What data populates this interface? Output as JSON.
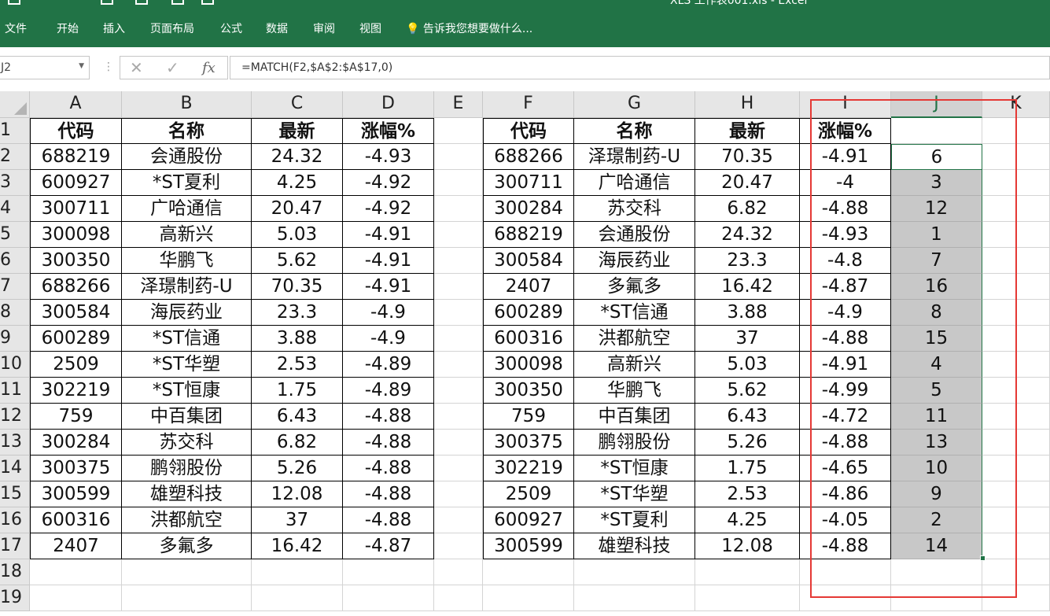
{
  "window": {
    "title": "XLS 工作表001.xls - Excel"
  },
  "ribbon": {
    "tabs": [
      "文件",
      "开始",
      "插入",
      "页面布局",
      "公式",
      "数据",
      "审阅",
      "视图"
    ],
    "tell_me": "告诉我您想要做什么..."
  },
  "formula_bar": {
    "name_box": "J2",
    "cancel_icon": "✕",
    "enter_icon": "✓",
    "fx_label": "fx",
    "formula": "=MATCH(F2,$A$2:$A$17,0)"
  },
  "sheet": {
    "columns": [
      "A",
      "B",
      "C",
      "D",
      "E",
      "F",
      "G",
      "H",
      "I",
      "J",
      "K"
    ],
    "rows": [
      "1",
      "2",
      "3",
      "4",
      "5",
      "6",
      "7",
      "8",
      "9",
      "10",
      "11",
      "12",
      "13",
      "14",
      "15",
      "16",
      "17",
      "18",
      "19"
    ],
    "selected_column": "J",
    "active_cell": "J2",
    "left_table": {
      "headers": [
        "代码",
        "名称",
        "最新",
        "涨幅%"
      ],
      "rows": [
        [
          "688219",
          "会通股份",
          "24.32",
          "-4.93"
        ],
        [
          "600927",
          "*ST夏利",
          "4.25",
          "-4.92"
        ],
        [
          "300711",
          "广哈通信",
          "20.47",
          "-4.92"
        ],
        [
          "300098",
          "高新兴",
          "5.03",
          "-4.91"
        ],
        [
          "300350",
          "华鹏飞",
          "5.62",
          "-4.91"
        ],
        [
          "688266",
          "泽璟制药-U",
          "70.35",
          "-4.91"
        ],
        [
          "300584",
          "海辰药业",
          "23.3",
          "-4.9"
        ],
        [
          "600289",
          "*ST信通",
          "3.88",
          "-4.9"
        ],
        [
          "2509",
          "*ST华塑",
          "2.53",
          "-4.89"
        ],
        [
          "302219",
          "*ST恒康",
          "1.75",
          "-4.89"
        ],
        [
          "759",
          "中百集团",
          "6.43",
          "-4.88"
        ],
        [
          "300284",
          "苏交科",
          "6.82",
          "-4.88"
        ],
        [
          "300375",
          "鹏翎股份",
          "5.26",
          "-4.88"
        ],
        [
          "300599",
          "雄塑科技",
          "12.08",
          "-4.88"
        ],
        [
          "600316",
          "洪都航空",
          "37",
          "-4.88"
        ],
        [
          "2407",
          "多氟多",
          "16.42",
          "-4.87"
        ]
      ]
    },
    "right_table": {
      "headers": [
        "代码",
        "名称",
        "最新",
        "涨幅%"
      ],
      "rows": [
        [
          "688266",
          "泽璟制药-U",
          "70.35",
          "-4.91",
          "6"
        ],
        [
          "300711",
          "广哈通信",
          "20.47",
          "-4",
          "3"
        ],
        [
          "300284",
          "苏交科",
          "6.82",
          "-4.88",
          "12"
        ],
        [
          "688219",
          "会通股份",
          "24.32",
          "-4.93",
          "1"
        ],
        [
          "300584",
          "海辰药业",
          "23.3",
          "-4.8",
          "7"
        ],
        [
          "2407",
          "多氟多",
          "16.42",
          "-4.87",
          "16"
        ],
        [
          "600289",
          "*ST信通",
          "3.88",
          "-4.9",
          "8"
        ],
        [
          "600316",
          "洪都航空",
          "37",
          "-4.88",
          "15"
        ],
        [
          "300098",
          "高新兴",
          "5.03",
          "-4.91",
          "4"
        ],
        [
          "300350",
          "华鹏飞",
          "5.62",
          "-4.99",
          "5"
        ],
        [
          "759",
          "中百集团",
          "6.43",
          "-4.72",
          "11"
        ],
        [
          "300375",
          "鹏翎股份",
          "5.26",
          "-4.88",
          "13"
        ],
        [
          "302219",
          "*ST恒康",
          "1.75",
          "-4.65",
          "10"
        ],
        [
          "2509",
          "*ST华塑",
          "2.53",
          "-4.86",
          "9"
        ],
        [
          "600927",
          "*ST夏利",
          "4.25",
          "-4.05",
          "2"
        ],
        [
          "300599",
          "雄塑科技",
          "12.08",
          "-4.88",
          "14"
        ]
      ]
    }
  },
  "colors": {
    "excel_green": "#217346",
    "highlight_red": "#e53935",
    "selection_gray": "#c8c8c8"
  }
}
